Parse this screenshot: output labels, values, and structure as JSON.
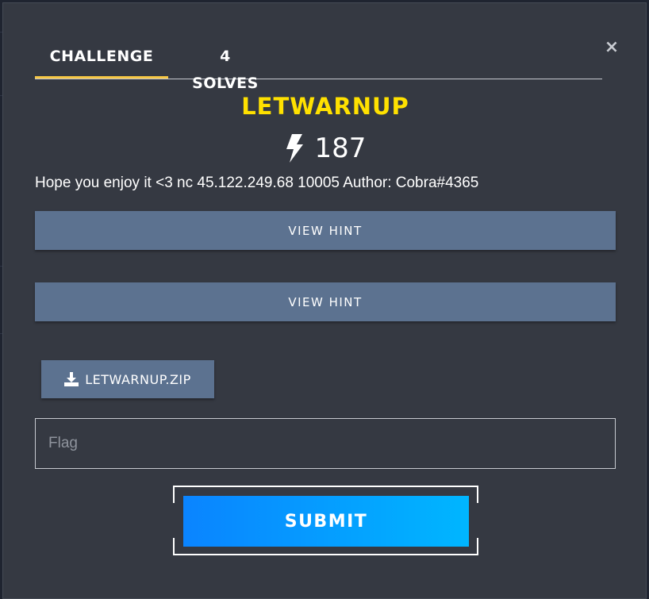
{
  "modal": {
    "close_glyph": "×"
  },
  "tabs": [
    {
      "label": "Challenge",
      "active": true
    },
    {
      "label": "4 Solves",
      "active": false
    }
  ],
  "challenge": {
    "name": "LETWARNUP",
    "points": "187",
    "points_icon": "lightning-bolt-icon",
    "description": "Hope you enjoy it <3 nc 45.122.249.68 10005 Author: Cobra#4365"
  },
  "hints": [
    {
      "label": "View Hint"
    },
    {
      "label": "View Hint"
    }
  ],
  "files": [
    {
      "label": "letwarnup.zip",
      "icon": "download-icon"
    }
  ],
  "flag_input": {
    "placeholder": "Flag",
    "value": ""
  },
  "submit": {
    "label": "Submit"
  },
  "colors": {
    "modal_bg": "#353942",
    "title": "#ffe100",
    "tab_underline": "#f6c744",
    "hint_button": "#5c7290",
    "submit_gradient_start": "#0a84ff",
    "submit_gradient_end": "#00b6ff"
  }
}
